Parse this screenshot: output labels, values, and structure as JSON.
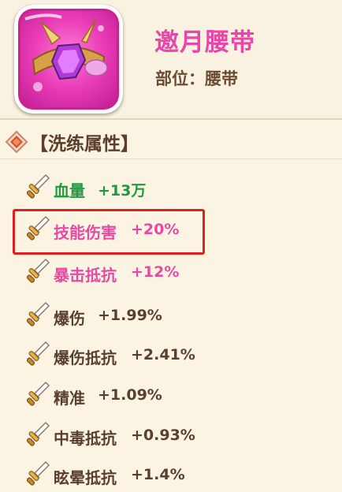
{
  "item": {
    "name": "邀月腰带",
    "slot_label": "部位：",
    "slot_value": "腰带",
    "rarity_color": "#e93bb6",
    "icon": "belt-icon"
  },
  "section": {
    "title": "【洗练属性】",
    "badge_icon": "diamond-badge-icon"
  },
  "attributes": [
    {
      "name": "血量",
      "value": "+13万",
      "color": "#1e9a3e",
      "highlighted": false
    },
    {
      "name": "技能伤害",
      "value": "+20%",
      "color": "#e64aa3",
      "highlighted": true
    },
    {
      "name": "暴击抵抗",
      "value": "+12%",
      "color": "#e64aa3",
      "highlighted": false
    },
    {
      "name": "爆伤",
      "value": "+1.99%",
      "color": "#5a3f2e",
      "highlighted": false
    },
    {
      "name": "爆伤抵抗",
      "value": "+2.41%",
      "color": "#5a3f2e",
      "highlighted": false
    },
    {
      "name": "精准",
      "value": "+1.09%",
      "color": "#5a3f2e",
      "highlighted": false
    },
    {
      "name": "中毒抵抗",
      "value": "+0.93%",
      "color": "#5a3f2e",
      "highlighted": false
    },
    {
      "name": "眩晕抵抗",
      "value": "+1.4%",
      "color": "#5a3f2e",
      "highlighted": false
    }
  ]
}
